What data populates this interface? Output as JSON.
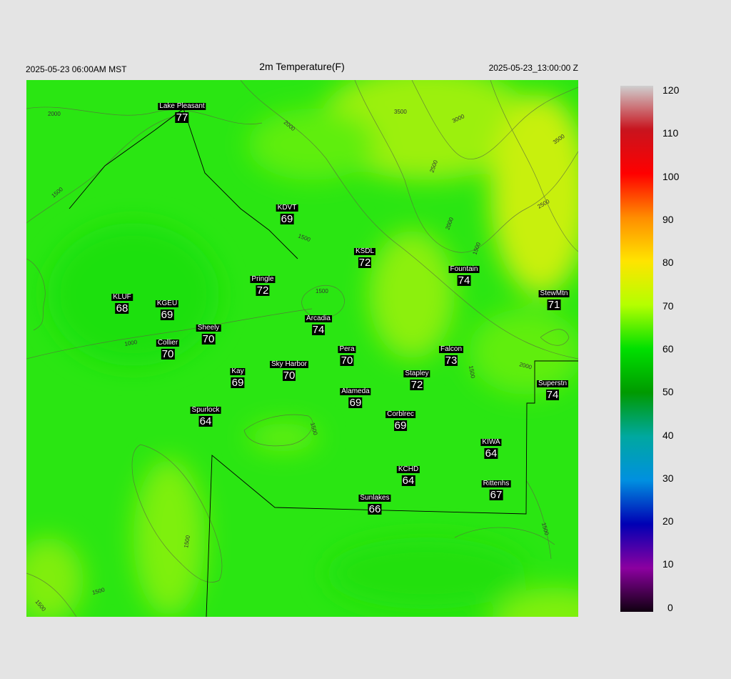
{
  "header": {
    "left": "2025-05-23 06:00AM MST",
    "title": "2m Temperature(F)",
    "right": "2025-05-23_13:00:00 Z"
  },
  "stations": [
    {
      "name": "Lake Pleasant",
      "value": "77"
    },
    {
      "name": "KDVT",
      "value": "69"
    },
    {
      "name": "KSDL",
      "value": "72"
    },
    {
      "name": "Fountain",
      "value": "74"
    },
    {
      "name": "Pringle",
      "value": "72"
    },
    {
      "name": "StewMtn",
      "value": "71"
    },
    {
      "name": "KLUF",
      "value": "68"
    },
    {
      "name": "KGEU",
      "value": "69"
    },
    {
      "name": "Arcadia",
      "value": "74"
    },
    {
      "name": "Sheely",
      "value": "70"
    },
    {
      "name": "Collier",
      "value": "70"
    },
    {
      "name": "Pera",
      "value": "70"
    },
    {
      "name": "Falcon",
      "value": "73"
    },
    {
      "name": "Sky Harbor",
      "value": "70"
    },
    {
      "name": "Kay",
      "value": "69"
    },
    {
      "name": "Stapley",
      "value": "72"
    },
    {
      "name": "Superstn",
      "value": "74"
    },
    {
      "name": "Alameda",
      "value": "69"
    },
    {
      "name": "Spurlock",
      "value": "64"
    },
    {
      "name": "Corblrec",
      "value": "69"
    },
    {
      "name": "KIWA",
      "value": "64"
    },
    {
      "name": "KCHD",
      "value": "64"
    },
    {
      "name": "Rittenhs",
      "value": "67"
    },
    {
      "name": "Sunlakes",
      "value": "66"
    }
  ],
  "contour_labels": [
    "2000",
    "2000",
    "3500",
    "3000",
    "3500",
    "1500",
    "2500",
    "2500",
    "1500",
    "2000",
    "1500",
    "1500",
    "2000",
    "1000",
    "1500",
    "1500",
    "1500",
    "1500",
    "1500",
    "1500"
  ],
  "colorbar": {
    "ticks": [
      "120",
      "110",
      "100",
      "90",
      "80",
      "70",
      "60",
      "50",
      "40",
      "30",
      "20",
      "10",
      "0"
    ],
    "colors": [
      "#cfcfcf",
      "#c8141e",
      "#ff0000",
      "#ff8c00",
      "#ffe400",
      "#b4ff00",
      "#00e000",
      "#009a00",
      "#00a8a0",
      "#0090e0",
      "#0000b4",
      "#8c00a0",
      "#100010"
    ]
  }
}
